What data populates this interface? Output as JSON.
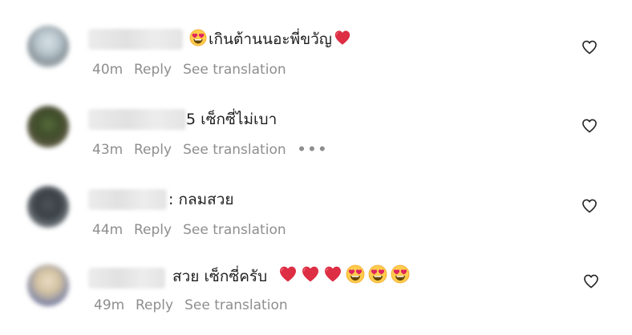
{
  "icons": {
    "like": "heart-outline-icon",
    "more": "more-horizontal-icon",
    "heart_eyes": "heart-eyes-emoji",
    "red_heart": "red-heart-emoji"
  },
  "comments": [
    {
      "username_tail": "",
      "text": "เกินต้านนอะพี่ขวัญ",
      "time": "40m",
      "reply": "Reply",
      "translate": "See translation",
      "more": ""
    },
    {
      "username_tail": "5",
      "text": "เซ็กซี่ไม่เบา",
      "time": "43m",
      "reply": "Reply",
      "translate": "See translation",
      "more": "•••"
    },
    {
      "username_tail": ":",
      "text": "กลมสวย",
      "time": "44m",
      "reply": "Reply",
      "translate": "See translation",
      "more": ""
    },
    {
      "username_tail": "",
      "text": "สวย เซ็กซี่ครับ",
      "time": "49m",
      "reply": "Reply",
      "translate": "See translation",
      "more": ""
    }
  ]
}
